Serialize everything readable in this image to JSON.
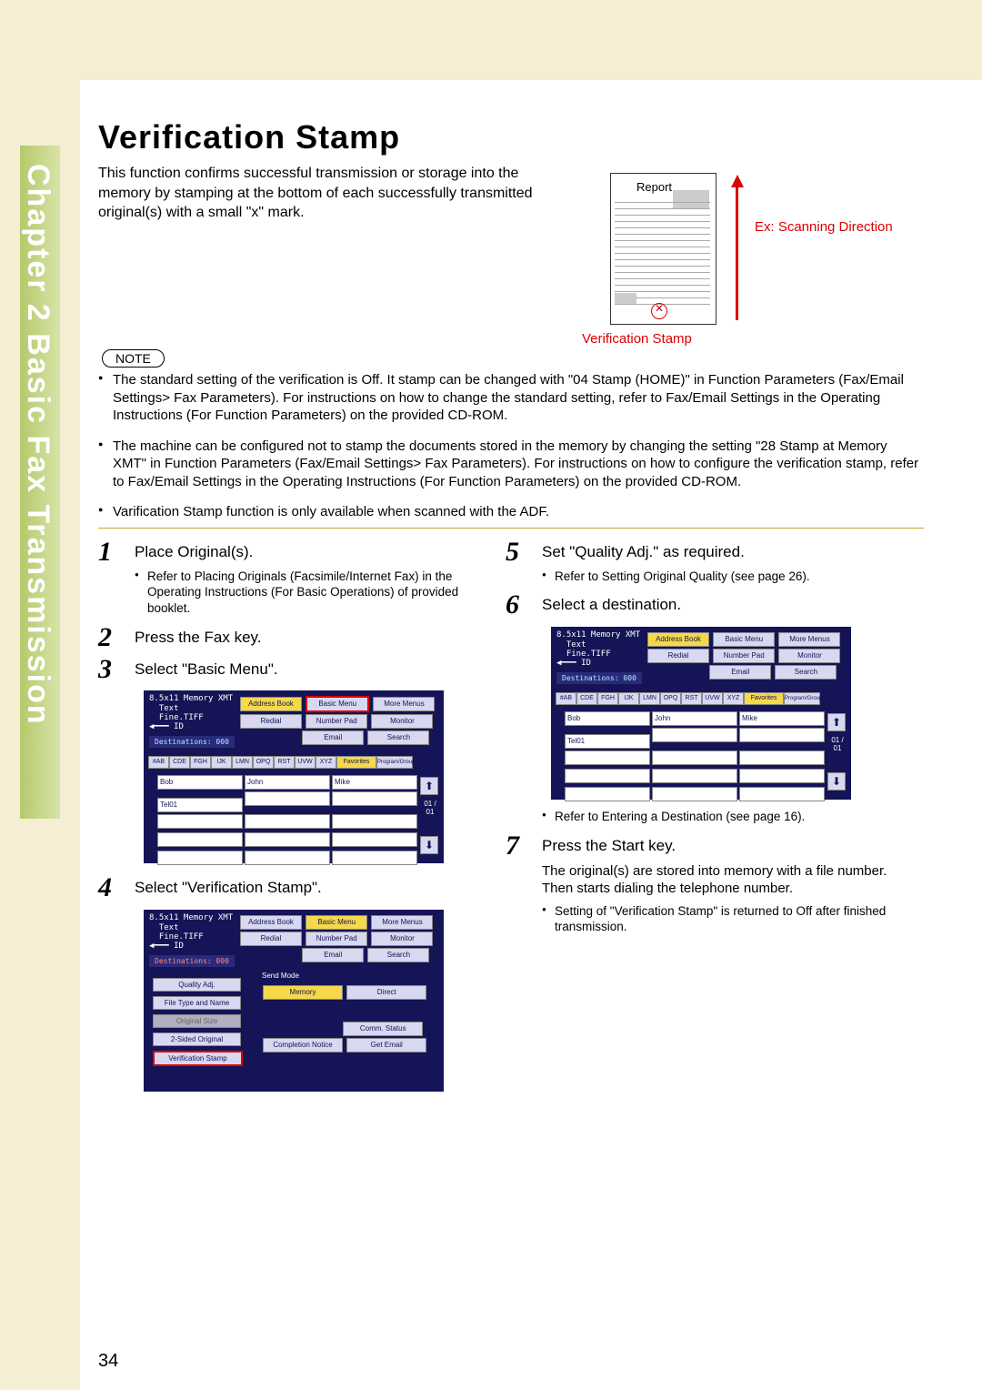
{
  "chapter": "Chapter 2   Basic Fax Transmission",
  "title": "Verification Stamp",
  "intro": "This function confirms successful transmission or storage into the memory by stamping at the bottom of each successfully transmitted original(s) with a small \"x\" mark.",
  "reportLabel": "Report",
  "scanDir": "Ex: Scanning Direction",
  "vstampLabel": "Verification Stamp",
  "noteBadge": "NOTE",
  "notes": [
    "The standard setting of the verification is Off. It stamp can be changed with \"04 Stamp (HOME)\" in Function Parameters (Fax/Email Settings> Fax Parameters). For instructions on how to change the standard setting, refer to Fax/Email Settings in the Operating Instructions (For Function Parameters) on the provided CD-ROM.",
    "The machine can be configured not to stamp the documents stored in the memory by changing the setting \"28 Stamp at Memory XMT\" in Function Parameters (Fax/Email Settings> Fax Parameters). For instructions on how to configure the verification stamp, refer to Fax/Email Settings in the Operating Instructions (For Function Parameters) on the provided CD-ROM.",
    "Varification Stamp function is only available when scanned with the ADF."
  ],
  "steps": {
    "s1": {
      "n": "1",
      "t": "Place Original(s).",
      "sub": "Refer to Placing Originals (Facsimile/Internet Fax) in the Operating Instructions (For Basic Operations) of provided booklet."
    },
    "s2": {
      "n": "2",
      "t": "Press the Fax key."
    },
    "s3": {
      "n": "3",
      "t": "Select \"Basic Menu\"."
    },
    "s4": {
      "n": "4",
      "t": "Select \"Verification Stamp\"."
    },
    "s5": {
      "n": "5",
      "t": "Set \"Quality Adj.\" as required.",
      "sub": "Refer to Setting Original Quality (see page 26)."
    },
    "s6": {
      "n": "6",
      "t": "Select a destination.",
      "sub": "Refer to Entering a Destination (see page 16)."
    },
    "s7": {
      "n": "7",
      "t": "Press the Start key.",
      "body": "The original(s) are stored into memory with a file number. Then starts dialing the telephone number.",
      "sub": "Setting of \"Verification Stamp\" is returned to Off after finished transmission."
    }
  },
  "ss": {
    "header": "8.5x11   Memory XMT",
    "hdr2": "Text",
    "hdr3": "Fine.TIFF",
    "hdr4": "ID",
    "topbtns": [
      "Address Book",
      "Basic Menu",
      "More Menus",
      "Redial",
      "Number Pad",
      "Monitor",
      "Email",
      "Search"
    ],
    "dest": "Destinations: 000",
    "tabs": [
      "#AB",
      "CDE",
      "FGH",
      "IJK",
      "LMN",
      "OPQ",
      "RST",
      "UVW",
      "XYZ",
      "Favorites",
      "Program/Group"
    ],
    "names": [
      "Bob",
      "John",
      "Mike",
      "Tel01"
    ],
    "counter": "01 / 01",
    "leftbtns": [
      "Quality Adj.",
      "File Type and Name",
      "Original Size",
      "2-Sided Original",
      "Verification Stamp"
    ],
    "rightbtns": [
      "Send Mode",
      "Memory",
      "Direct",
      "Comm. Status",
      "Completion Notice",
      "Get Email"
    ]
  },
  "page": "34"
}
